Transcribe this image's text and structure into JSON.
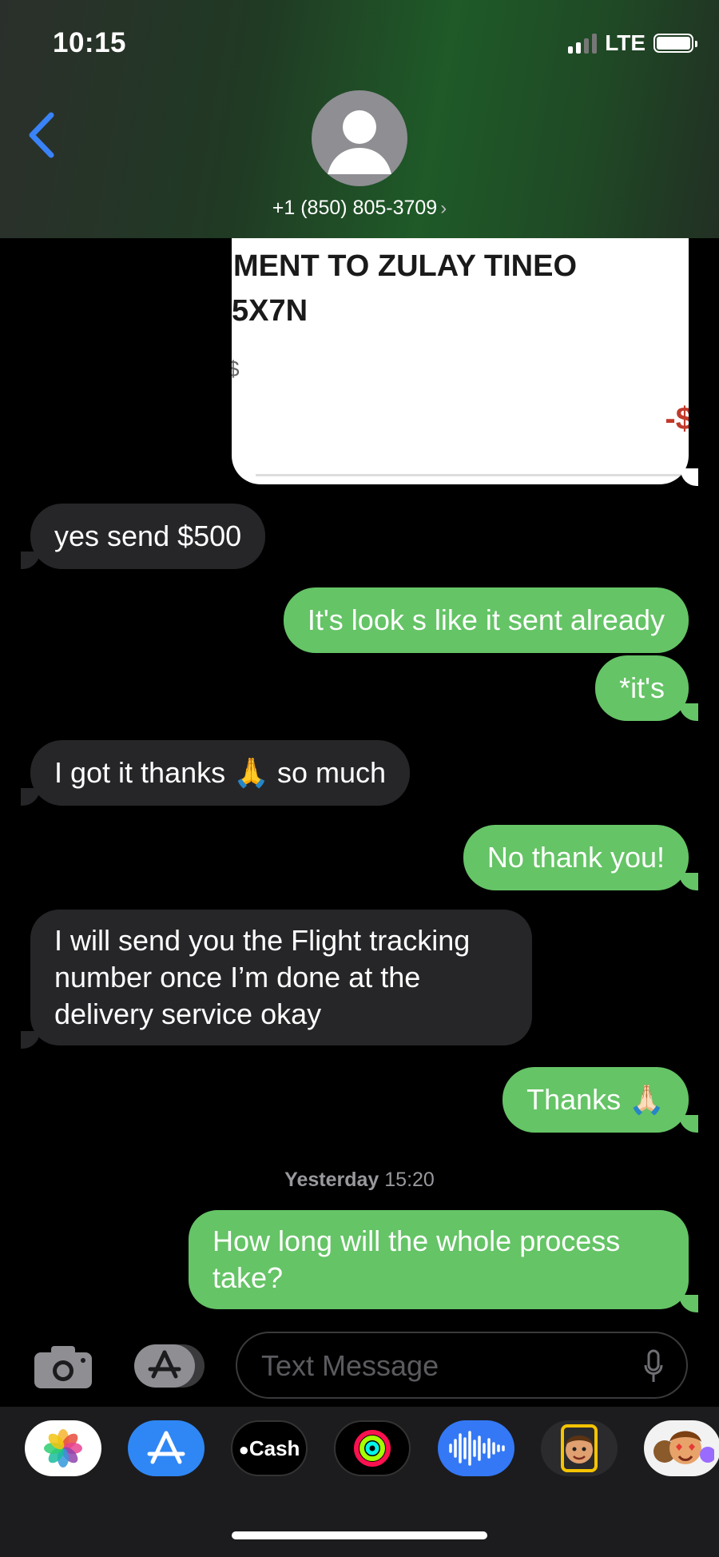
{
  "status_bar": {
    "time": "10:15",
    "network": "LTE"
  },
  "header": {
    "contact": "+1 (850) 805-3709",
    "chevron": "›"
  },
  "payment_card": {
    "line1": "MENT TO ZULAY TINEO",
    "line2": "5X7N",
    "line3": "$",
    "amount": "-$"
  },
  "messages": [
    {
      "dir": "in",
      "text": "yes send $500"
    },
    {
      "dir": "out",
      "text": "It's look s like it sent already"
    },
    {
      "dir": "out",
      "text": "*it's"
    },
    {
      "dir": "in",
      "text": "I got it thanks 🙏 so much"
    },
    {
      "dir": "out",
      "text": "No thank you!"
    },
    {
      "dir": "in",
      "text": "I will send you the Flight tracking number once I’m done at the delivery service okay"
    },
    {
      "dir": "out",
      "text": "Thanks 🙏🏻"
    },
    {
      "dir": "out",
      "text": "How long will the whole process take?"
    }
  ],
  "timestamp": {
    "day": "Yesterday",
    "time": "15:20"
  },
  "compose": {
    "placeholder": "Text Message"
  },
  "app_drawer": {
    "apps": [
      {
        "name": "Photos",
        "icon": "photos-icon"
      },
      {
        "name": "App Store",
        "icon": "app-store-icon"
      },
      {
        "name": "Cash",
        "label": "Cash",
        "icon": "apple-cash-icon"
      },
      {
        "name": "Activity",
        "icon": "activity-rings-icon"
      },
      {
        "name": "Audio",
        "icon": "audio-waveform-icon"
      },
      {
        "name": "Memoji",
        "icon": "memoji-icon"
      },
      {
        "name": "Memoji Stickers",
        "icon": "memoji-stickers-icon"
      }
    ]
  },
  "colors": {
    "outgoing": "#65c466",
    "incoming": "#262629",
    "back_chevron": "#3a82f7"
  }
}
